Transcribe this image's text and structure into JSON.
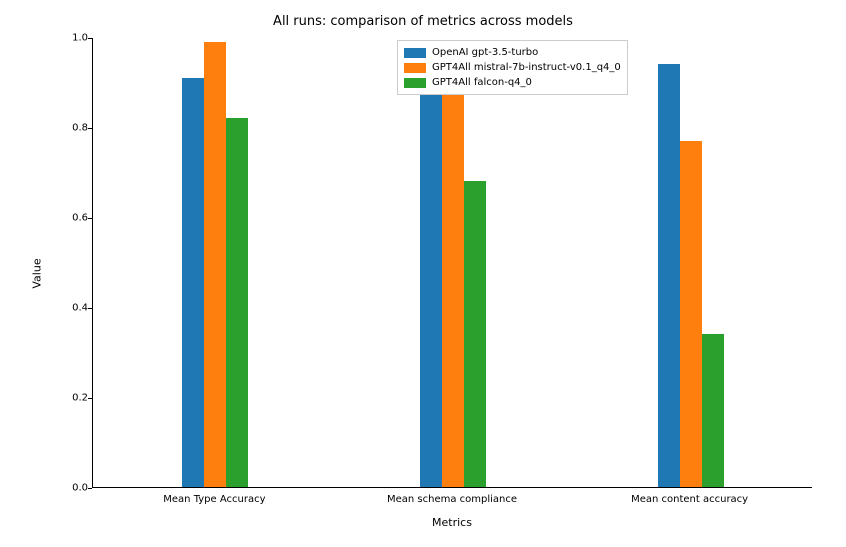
{
  "chart_data": {
    "type": "bar",
    "title": "All runs: comparison of metrics across models",
    "xlabel": "Metrics",
    "ylabel": "Value",
    "ylim": [
      0,
      1
    ],
    "yticks": [
      0.0,
      0.2,
      0.4,
      0.6,
      0.8,
      1.0
    ],
    "ytick_labels": [
      "0.0",
      "0.2",
      "0.4",
      "0.6",
      "0.8",
      "1.0"
    ],
    "categories": [
      "Mean Type Accuracy",
      "Mean schema compliance",
      "Mean content accuracy"
    ],
    "series": [
      {
        "name": "OpenAI gpt-3.5-turbo",
        "color": "#1f77b4",
        "values": [
          0.91,
          0.9,
          0.94
        ]
      },
      {
        "name": "GPT4All mistral-7b-instruct-v0.1_q4_0",
        "color": "#ff7f0e",
        "values": [
          0.99,
          0.93,
          0.77
        ]
      },
      {
        "name": "GPT4All falcon-q4_0",
        "color": "#2ca02c",
        "values": [
          0.82,
          0.68,
          0.34
        ]
      }
    ],
    "legend_position": "upper-right"
  }
}
